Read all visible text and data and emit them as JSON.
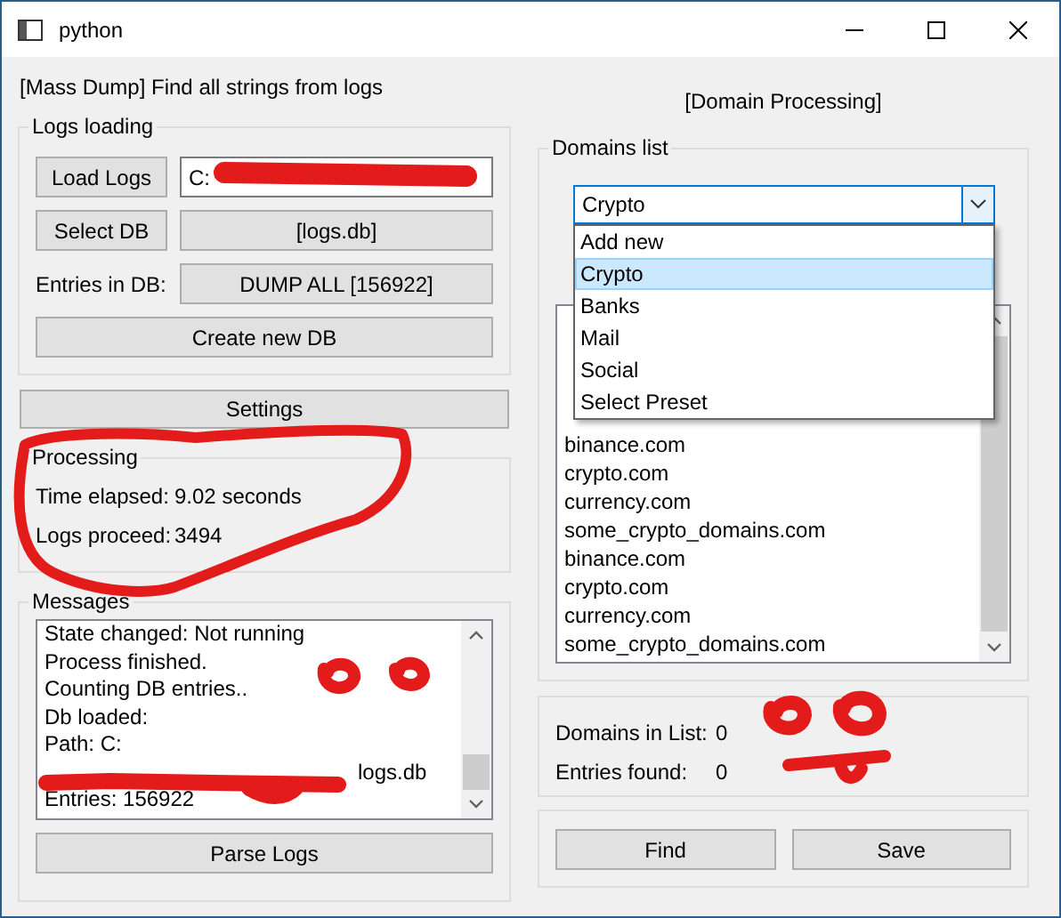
{
  "window": {
    "title": "python"
  },
  "left": {
    "heading": "[Mass Dump] Find all strings from logs",
    "logs_loading": {
      "title": "Logs loading",
      "load_button": "Load Logs",
      "path_value": "C:",
      "select_button": "Select DB",
      "db_button": "[logs.db]",
      "entries_label": "Entries in DB:",
      "dump_button": "DUMP ALL [156922]",
      "create_button": "Create new DB"
    },
    "settings_button": "Settings",
    "processing": {
      "title": "Processing",
      "rows": [
        {
          "label": "Time elapsed:",
          "value": "9.02 seconds"
        },
        {
          "label": "Logs proceed:",
          "value": "3494"
        }
      ]
    },
    "messages": {
      "title": "Messages",
      "lines": [
        "State changed: Not running",
        "Process finished.",
        "Counting DB entries..",
        "Db loaded:",
        "Path: C:",
        "logs.db",
        "Entries: 156922"
      ],
      "parse_button": "Parse Logs"
    }
  },
  "right": {
    "heading": "[Domain Processing]",
    "domains": {
      "title": "Domains list",
      "combo": {
        "value": "Crypto",
        "expanded": true,
        "options": [
          {
            "label": "Add new",
            "selected": false
          },
          {
            "label": "Crypto",
            "selected": true
          },
          {
            "label": "Banks",
            "selected": false
          },
          {
            "label": "Mail",
            "selected": false
          },
          {
            "label": "Social",
            "selected": false
          },
          {
            "label": "Select Preset",
            "selected": false
          }
        ]
      },
      "items": [
        "binance.com",
        "crypto.com",
        "currency.com",
        "some_crypto_domains.com",
        "binance.com",
        "crypto.com",
        "currency.com",
        "some_crypto_domains.com"
      ]
    },
    "stats": [
      {
        "label": "Domains in List:",
        "value": "0"
      },
      {
        "label": "Entries found:",
        "value": "0"
      }
    ],
    "buttons": [
      "Find",
      "Save"
    ]
  }
}
